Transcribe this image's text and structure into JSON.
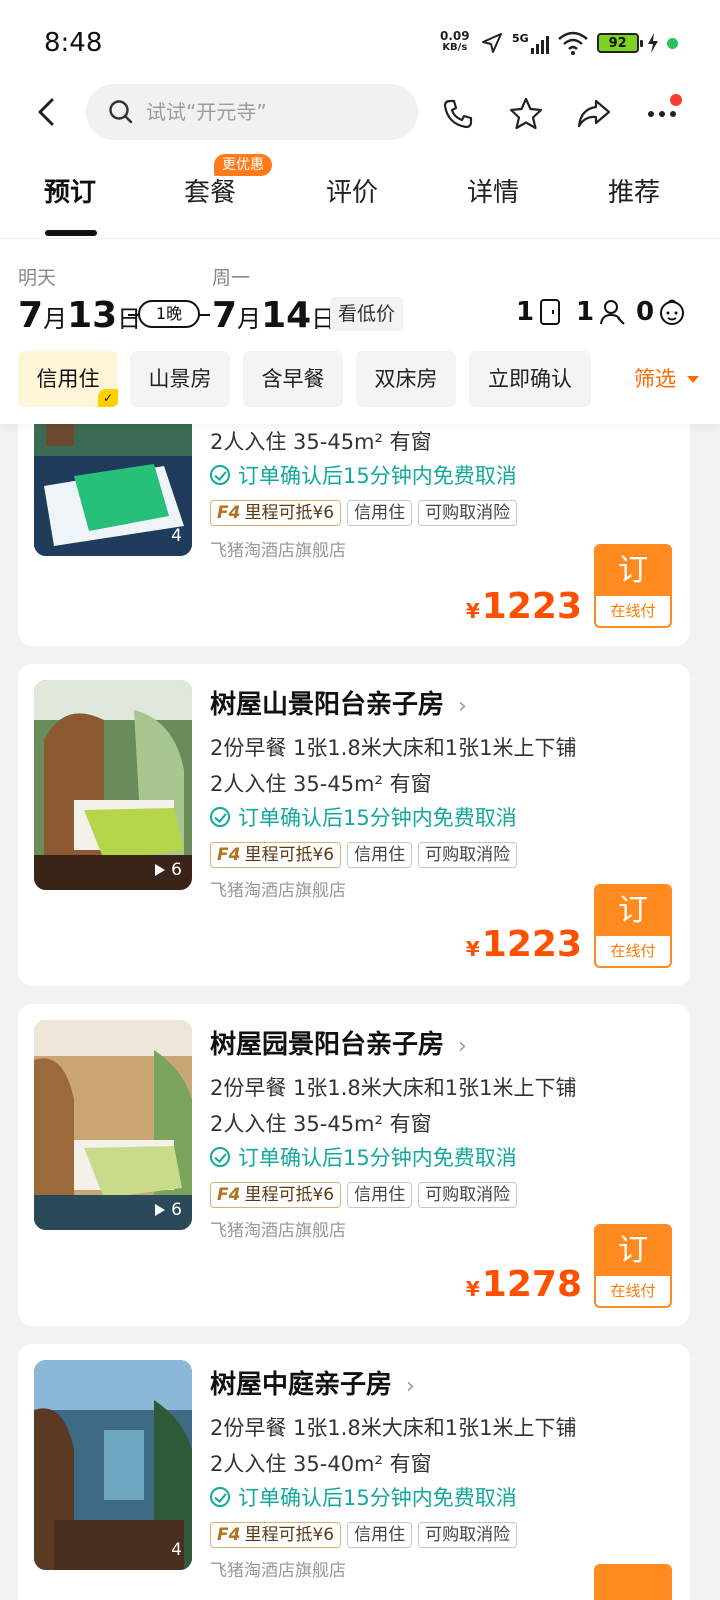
{
  "status_bar": {
    "time": "8:48",
    "net_speed_top": "0.09",
    "net_speed_unit": "KB/s",
    "signal_label": "5G",
    "battery": "92",
    "colors": {
      "battery_fill": "#7ed321",
      "dot": "#2ec15a"
    }
  },
  "header": {
    "search_placeholder": "试试“开元寺”",
    "icons": [
      "back-icon",
      "search-icon",
      "phone-icon",
      "star-icon",
      "share-icon",
      "more-icon"
    ]
  },
  "tabs": [
    {
      "label": "预订",
      "active": true
    },
    {
      "label": "套餐",
      "badge": "更优惠"
    },
    {
      "label": "评价"
    },
    {
      "label": "详情"
    },
    {
      "label": "推荐"
    }
  ],
  "dates": {
    "checkin_label": "明天",
    "checkin_month": "7",
    "checkin_month_unit": "月",
    "checkin_day": "13",
    "checkin_day_unit": "日",
    "nights": "1晚",
    "checkout_label": "周一",
    "checkout_month": "7",
    "checkout_month_unit": "月",
    "checkout_day": "14",
    "checkout_day_unit": "日",
    "low_price": "看低价",
    "rooms": "1",
    "adults": "1",
    "children": "0"
  },
  "filters": {
    "chips": [
      "信用住",
      "山景房",
      "含早餐",
      "双床房",
      "立即确认"
    ],
    "filter_label": "筛选",
    "accent": "#ff6a00"
  },
  "rooms": [
    {
      "title": "",
      "breakfast_bed": "",
      "occupancy": "2人入住   35-45m²   有窗",
      "cancel": "订单确认后15分钟内免费取消",
      "tag_f4": "F4",
      "tag_mileage": "里程可抵¥6",
      "tag_credit": "信用住",
      "tag_insurance": "可购取消险",
      "shop": "飞猪淘酒店旗舰店",
      "currency": "¥",
      "price": "1223",
      "book": "订",
      "pay": "在线付",
      "photo_count": "4"
    },
    {
      "title": "树屋山景阳台亲子房",
      "breakfast_bed": "2份早餐   1张1.8米大床和1张1米上下铺",
      "occupancy": "2人入住   35-45m²   有窗",
      "cancel": "订单确认后15分钟内免费取消",
      "tag_f4": "F4",
      "tag_mileage": "里程可抵¥6",
      "tag_credit": "信用住",
      "tag_insurance": "可购取消险",
      "shop": "飞猪淘酒店旗舰店",
      "currency": "¥",
      "price": "1223",
      "book": "订",
      "pay": "在线付",
      "photo_count": "6"
    },
    {
      "title": "树屋园景阳台亲子房",
      "breakfast_bed": "2份早餐   1张1.8米大床和1张1米上下铺",
      "occupancy": "2人入住   35-45m²   有窗",
      "cancel": "订单确认后15分钟内免费取消",
      "tag_f4": "F4",
      "tag_mileage": "里程可抵¥6",
      "tag_credit": "信用住",
      "tag_insurance": "可购取消险",
      "shop": "飞猪淘酒店旗舰店",
      "currency": "¥",
      "price": "1278",
      "book": "订",
      "pay": "在线付",
      "photo_count": "6"
    },
    {
      "title": "树屋中庭亲子房",
      "breakfast_bed": "2份早餐   1张1.8米大床和1张1米上下铺",
      "occupancy": "2人入住   35-40m²   有窗",
      "cancel": "订单确认后15分钟内免费取消",
      "tag_f4": "F4",
      "tag_mileage": "里程可抵¥6",
      "tag_credit": "信用住",
      "tag_insurance": "可购取消险",
      "shop": "飞猪淘酒店旗舰店",
      "photo_count": "4"
    }
  ]
}
